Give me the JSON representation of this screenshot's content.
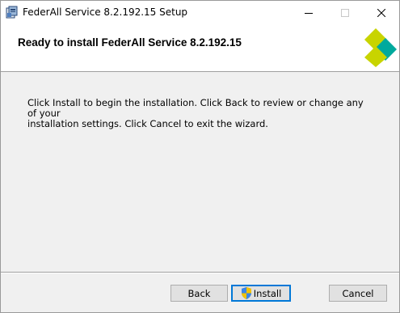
{
  "window": {
    "title": "FederAll Service 8.2.192.15 Setup",
    "controls": [
      "minimize-icon",
      "maximize-icon",
      "close-icon"
    ]
  },
  "header": {
    "title": "Ready to install FederAll Service 8.2.192.15",
    "logo_colors": [
      "#c8d400",
      "#00a99d"
    ]
  },
  "main": {
    "description_line1": "Click Install to begin the installation. Click Back to review or change any of your",
    "description_line2": "installation settings. Click Cancel to exit the wizard."
  },
  "footer": {
    "back_label": "Back",
    "install_label": "Install",
    "cancel_label": "Cancel",
    "accent": "#0078d7"
  }
}
